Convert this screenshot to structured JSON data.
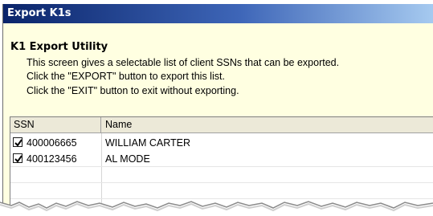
{
  "window": {
    "title": "Export K1s"
  },
  "header": {
    "heading": "K1 Export Utility",
    "lines": [
      "This screen gives a selectable list of client SSNs that can be exported.",
      "Click the \"EXPORT\" button to export this list.",
      "Click the \"EXIT\" button to exit without exporting."
    ]
  },
  "list": {
    "columns": [
      "SSN",
      "Name"
    ],
    "rows": [
      {
        "checked": true,
        "ssn": "400006665",
        "name": "WILLIAM CARTER"
      },
      {
        "checked": true,
        "ssn": "400123456",
        "name": "AL MODE"
      }
    ]
  },
  "colors": {
    "title_bar_start": "#0a246a",
    "title_bar_end": "#a6caf0",
    "panel_bg": "#ffffe1"
  }
}
